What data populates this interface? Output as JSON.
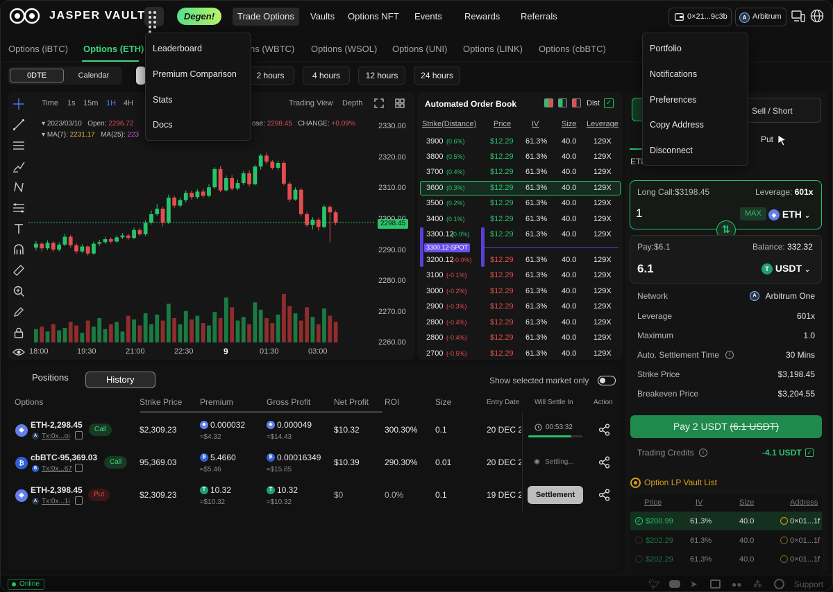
{
  "brand": {
    "name": "JASPER VAULT"
  },
  "nav": {
    "degen": "Degen!",
    "items": [
      "Trade Options",
      "Vaults",
      "Options NFT",
      "Events",
      "Rewards",
      "Referrals"
    ],
    "wallet": "0×21...9c3b",
    "chain": "Arbitrum"
  },
  "apps_menu": {
    "items": [
      "Leaderboard",
      "Premium Comparison",
      "Stats",
      "Docs"
    ]
  },
  "account_menu": {
    "items": [
      "Portfolio",
      "Notifications",
      "Preferences",
      "Copy Address",
      "Disconnect"
    ]
  },
  "market_tabs": [
    "Options (iBTC)",
    "Options (ETH)",
    "ns (WBTC)",
    "Options (WSOL)",
    "Options (UNI)",
    "Options (LINK)",
    "Options (cbBTC)"
  ],
  "expiry": {
    "seg_on": "0DTE",
    "seg_off": "Calendar",
    "options": [
      "2 hours",
      "4 hours",
      "12 hours",
      "24 hours"
    ]
  },
  "chart": {
    "timeframes": [
      "Time",
      "1s",
      "15m",
      "1H",
      "4H"
    ],
    "view_trading": "Trading View",
    "view_depth": "Depth",
    "date": "2023/03/10",
    "open_label": "Open:",
    "open_value": "2296.72",
    "close_label": "ose:",
    "close_value": "2298.45",
    "change_label": "CHANGE:",
    "change_value": "+0.09%",
    "ma7_label": "MA(7):",
    "ma7_value": "2231.17",
    "ma25_label": "MA(25):",
    "ma25_value": "223",
    "price_tag": "2298.45",
    "colors": {
      "up": "#27c26a",
      "down": "#e44d4d"
    }
  },
  "chart_data": {
    "type": "candlestick",
    "title": "",
    "y_ticks": [
      "2330.00",
      "2320.00",
      "2310.00",
      "2300.00",
      "2290.00",
      "2280.00",
      "2270.00",
      "2260.00"
    ],
    "x_ticks": [
      "18:00",
      "19:30",
      "21:00",
      "22:30",
      "9",
      "01:30",
      "03:00"
    ],
    "ylim": [
      2258,
      2333
    ],
    "last_price": 2298.45,
    "candles": [
      {
        "o": 2290.2,
        "c": 2291.5,
        "h": 2292.4,
        "l": 2289.3
      },
      {
        "o": 2291.5,
        "c": 2290.0,
        "h": 2292.0,
        "l": 2289.0
      },
      {
        "o": 2290.0,
        "c": 2291.8,
        "h": 2292.6,
        "l": 2289.4
      },
      {
        "o": 2291.8,
        "c": 2289.6,
        "h": 2292.3,
        "l": 2288.8
      },
      {
        "o": 2289.6,
        "c": 2291.2,
        "h": 2292.0,
        "l": 2289.0
      },
      {
        "o": 2291.2,
        "c": 2293.8,
        "h": 2294.8,
        "l": 2290.7
      },
      {
        "o": 2293.8,
        "c": 2291.0,
        "h": 2294.4,
        "l": 2290.2
      },
      {
        "o": 2291.0,
        "c": 2289.0,
        "h": 2291.8,
        "l": 2288.2
      },
      {
        "o": 2289.0,
        "c": 2290.6,
        "h": 2291.4,
        "l": 2288.4
      },
      {
        "o": 2290.6,
        "c": 2288.3,
        "h": 2291.0,
        "l": 2287.6
      },
      {
        "o": 2288.3,
        "c": 2291.5,
        "h": 2292.2,
        "l": 2287.8
      },
      {
        "o": 2291.5,
        "c": 2292.0,
        "h": 2292.8,
        "l": 2290.8
      },
      {
        "o": 2292.0,
        "c": 2293.0,
        "h": 2293.8,
        "l": 2291.4
      },
      {
        "o": 2293.0,
        "c": 2292.2,
        "h": 2293.6,
        "l": 2291.6
      },
      {
        "o": 2292.2,
        "c": 2293.6,
        "h": 2294.3,
        "l": 2291.8
      },
      {
        "o": 2293.6,
        "c": 2294.2,
        "h": 2295.0,
        "l": 2293.0
      },
      {
        "o": 2294.2,
        "c": 2293.4,
        "h": 2294.8,
        "l": 2292.8
      },
      {
        "o": 2293.4,
        "c": 2296.0,
        "h": 2296.8,
        "l": 2293.0
      },
      {
        "o": 2296.0,
        "c": 2294.6,
        "h": 2296.6,
        "l": 2294.0
      },
      {
        "o": 2294.6,
        "c": 2298.4,
        "h": 2299.2,
        "l": 2294.0
      },
      {
        "o": 2298.4,
        "c": 2301.2,
        "h": 2302.4,
        "l": 2297.8
      },
      {
        "o": 2301.2,
        "c": 2303.0,
        "h": 2304.6,
        "l": 2300.6
      },
      {
        "o": 2303.0,
        "c": 2298.4,
        "h": 2303.6,
        "l": 2297.2
      },
      {
        "o": 2298.4,
        "c": 2306.6,
        "h": 2307.6,
        "l": 2298.0
      },
      {
        "o": 2306.6,
        "c": 2304.0,
        "h": 2307.2,
        "l": 2303.2
      },
      {
        "o": 2304.0,
        "c": 2305.8,
        "h": 2306.6,
        "l": 2303.4
      },
      {
        "o": 2305.8,
        "c": 2308.2,
        "h": 2309.0,
        "l": 2305.0
      },
      {
        "o": 2308.2,
        "c": 2306.8,
        "h": 2309.0,
        "l": 2306.0
      },
      {
        "o": 2306.8,
        "c": 2308.6,
        "h": 2309.4,
        "l": 2306.2
      },
      {
        "o": 2308.6,
        "c": 2307.2,
        "h": 2309.6,
        "l": 2306.6
      },
      {
        "o": 2307.2,
        "c": 2310.0,
        "h": 2311.0,
        "l": 2306.8
      },
      {
        "o": 2310.0,
        "c": 2316.0,
        "h": 2316.6,
        "l": 2309.4
      },
      {
        "o": 2316.0,
        "c": 2309.0,
        "h": 2317.0,
        "l": 2308.4
      },
      {
        "o": 2309.0,
        "c": 2313.0,
        "h": 2313.8,
        "l": 2308.6
      },
      {
        "o": 2313.0,
        "c": 2309.6,
        "h": 2314.0,
        "l": 2309.0
      },
      {
        "o": 2309.6,
        "c": 2311.4,
        "h": 2312.6,
        "l": 2309.0
      },
      {
        "o": 2311.4,
        "c": 2314.6,
        "h": 2315.4,
        "l": 2310.8
      },
      {
        "o": 2314.6,
        "c": 2311.0,
        "h": 2315.6,
        "l": 2310.2
      },
      {
        "o": 2311.0,
        "c": 2316.8,
        "h": 2317.4,
        "l": 2310.6
      },
      {
        "o": 2316.8,
        "c": 2320.4,
        "h": 2321.0,
        "l": 2315.8
      },
      {
        "o": 2320.4,
        "c": 2318.4,
        "h": 2321.4,
        "l": 2317.6
      },
      {
        "o": 2318.4,
        "c": 2316.4,
        "h": 2319.0,
        "l": 2315.8
      },
      {
        "o": 2316.4,
        "c": 2318.0,
        "h": 2318.8,
        "l": 2315.6
      },
      {
        "o": 2318.0,
        "c": 2311.2,
        "h": 2318.6,
        "l": 2310.6
      },
      {
        "o": 2311.2,
        "c": 2306.0,
        "h": 2311.8,
        "l": 2305.2
      },
      {
        "o": 2306.0,
        "c": 2309.2,
        "h": 2310.0,
        "l": 2305.6
      },
      {
        "o": 2309.2,
        "c": 2301.2,
        "h": 2309.8,
        "l": 2300.4
      },
      {
        "o": 2301.2,
        "c": 2297.6,
        "h": 2302.0,
        "l": 2297.0
      },
      {
        "o": 2297.6,
        "c": 2299.4,
        "h": 2300.2,
        "l": 2296.2
      },
      {
        "o": 2299.4,
        "c": 2297.0,
        "h": 2300.0,
        "l": 2295.8
      },
      {
        "o": 2297.0,
        "c": 2303.6,
        "h": 2304.2,
        "l": 2296.6
      },
      {
        "o": 2303.6,
        "c": 2301.8,
        "h": 2304.0,
        "l": 2292.0
      },
      {
        "o": 2301.8,
        "c": 2298.4,
        "h": 2302.4,
        "l": 2297.6
      }
    ],
    "volumes": [
      22,
      26,
      18,
      30,
      20,
      24,
      34,
      28,
      16,
      36,
      26,
      40,
      22,
      30,
      34,
      18,
      44,
      38,
      28,
      48,
      30,
      46,
      36,
      64,
      40,
      30,
      52,
      38,
      44,
      32,
      28,
      50,
      40,
      74,
      58,
      36,
      42,
      30,
      66,
      54,
      40,
      32,
      46,
      80,
      60,
      48,
      36,
      58,
      42,
      30,
      56,
      44,
      34
    ]
  },
  "orderbook": {
    "title": "Automated Order Book",
    "dist_label": "Dist",
    "headers": [
      "Strike(Distance)",
      "Price",
      "IV",
      "Size",
      "Leverage"
    ],
    "calls": [
      {
        "strike": "3900",
        "dist": "(0.6%)",
        "price": "$12.29",
        "iv": "61.3%",
        "size": "40.0",
        "lev": "129X"
      },
      {
        "strike": "3800",
        "dist": "(0.5%)",
        "price": "$12.29",
        "iv": "61.3%",
        "size": "40.0",
        "lev": "129X"
      },
      {
        "strike": "3700",
        "dist": "(0.4%)",
        "price": "$12.29",
        "iv": "61.3%",
        "size": "40.0",
        "lev": "129X"
      },
      {
        "strike": "3600",
        "dist": "(0.3%)",
        "price": "$12.29",
        "iv": "61.3%",
        "size": "40.0",
        "lev": "129X"
      },
      {
        "strike": "3500",
        "dist": "(0.2%)",
        "price": "$12.29",
        "iv": "61.3%",
        "size": "40.0",
        "lev": "129X"
      },
      {
        "strike": "3400",
        "dist": "(0.1%)",
        "price": "$12.29",
        "iv": "61.3%",
        "size": "40.0",
        "lev": "129X"
      },
      {
        "strike": "3300.12",
        "dist": "(0.0%)",
        "price": "$12.29",
        "iv": "61.3%",
        "size": "40.0",
        "lev": "129X"
      }
    ],
    "spot": "3300.12-SPOT",
    "puts": [
      {
        "strike": "3200.12",
        "dist": "(-0.0%)",
        "price": "$12.29",
        "iv": "61.3%",
        "size": "40.0",
        "lev": "129X"
      },
      {
        "strike": "3100",
        "dist": "(-0.1%)",
        "price": "$12.29",
        "iv": "61.3%",
        "size": "40.0",
        "lev": "129X"
      },
      {
        "strike": "3000",
        "dist": "(-0.2%)",
        "price": "$12.29",
        "iv": "61.3%",
        "size": "40.0",
        "lev": "129X"
      },
      {
        "strike": "2900",
        "dist": "(-0.3%)",
        "price": "$12.29",
        "iv": "61.3%",
        "size": "40.0",
        "lev": "129X"
      },
      {
        "strike": "2800",
        "dist": "(-0.4%)",
        "price": "$12.29",
        "iv": "61.3%",
        "size": "40.0",
        "lev": "129X"
      },
      {
        "strike": "2800",
        "dist": "(-0.4%)",
        "price": "$12.29",
        "iv": "61.3%",
        "size": "40.0",
        "lev": "129X"
      },
      {
        "strike": "2700",
        "dist": "(-0.5%)",
        "price": "$12.29",
        "iv": "61.3%",
        "size": "40.0",
        "lev": "129X"
      }
    ]
  },
  "positions": {
    "tab_positions": "Positions",
    "tab_history": "History",
    "toggle_label": "Show selected market only",
    "headers": [
      "Options",
      "Strike Price",
      "Premium",
      "Gross Profit",
      "Net Profit",
      "ROI",
      "Size",
      "Entry Date",
      "Will Settle In",
      "Action"
    ],
    "rows": [
      {
        "name": "ETH-2,298.45",
        "tx": "Tx:0x...oi",
        "type": "Call",
        "strike": "$2,309.23",
        "premium": "0.000032",
        "premium_usd": "≈$4.32",
        "gross": "0.000049",
        "gross_usd": "≈$14.43",
        "net": "$10.32",
        "roi": "300.30%",
        "size": "0.1",
        "entry": "20 DEC 2",
        "settle": "00:53:32",
        "settle_progress": 0.8
      },
      {
        "name": "cbBTC-95,369.03",
        "tx": "Tx:0x...67",
        "type": "Call",
        "strike": "95,369.03",
        "premium": "5.4660",
        "premium_usd": "≈$5.46",
        "gross": "0.00016349",
        "gross_usd": "≈$15.85",
        "net": "$10.39",
        "roi": "290.30%",
        "size": "0.01",
        "entry": "20 DEC 2",
        "settle": "Settling..."
      },
      {
        "name": "ETH-2,398.45",
        "tx": "Tx:0x...1i",
        "type": "Put",
        "strike": "$2,309.23",
        "premium": "10.32",
        "premium_usd": "≈$10.32",
        "gross": "10.32",
        "gross_usd": "≈$10.32",
        "net": "$0",
        "roi": "0.0%",
        "size": "0.1",
        "entry": "19 DEC 2",
        "settle": "Settlement"
      }
    ]
  },
  "trade": {
    "tab_sell": "Sell / Short",
    "tab_put": "Put",
    "eth_tab": "ETH",
    "long_label": "Long Call:$3198.45",
    "leverage_label": "Leverage:",
    "leverage_value": "601x",
    "amount": "1",
    "max": "MAX",
    "asset": "ETH",
    "pay_label": "Pay:$6.1",
    "balance_label": "Balance:",
    "balance_value": "332.32",
    "pay_amount": "6.1",
    "pay_asset": "USDT",
    "details": [
      {
        "label": "Network",
        "value": "Arbitrum One"
      },
      {
        "label": "Leverage",
        "value": "601x"
      },
      {
        "label": "Maximum",
        "value": "1.0"
      },
      {
        "label": "Auto. Settlement Time",
        "value": "30 Mins"
      },
      {
        "label": "Strike Price",
        "value": "$3,198.45"
      },
      {
        "label": "Breakeven Price",
        "value": "$3,204.55"
      }
    ],
    "pay_button": "Pay 2 USDT",
    "pay_button_strike": "(6.1 USDT)",
    "credits_label": "Trading Credits",
    "credits_value": "-4.1 USDT",
    "vault_title": "Option LP Vault List",
    "vault_headers": [
      "Price",
      "IV",
      "Size",
      "Address"
    ],
    "vault_rows": [
      {
        "price": "$200.99",
        "iv": "61.3%",
        "size": "40.0",
        "addr": "0×01...1f"
      },
      {
        "price": "$202.29",
        "iv": "61.3%",
        "size": "40.0",
        "addr": "0×01...1f"
      },
      {
        "price": "$202.29",
        "iv": "61.3%",
        "size": "40.0",
        "addr": "0×01...1f"
      }
    ]
  },
  "footer": {
    "status": "Online",
    "support": "Support"
  }
}
